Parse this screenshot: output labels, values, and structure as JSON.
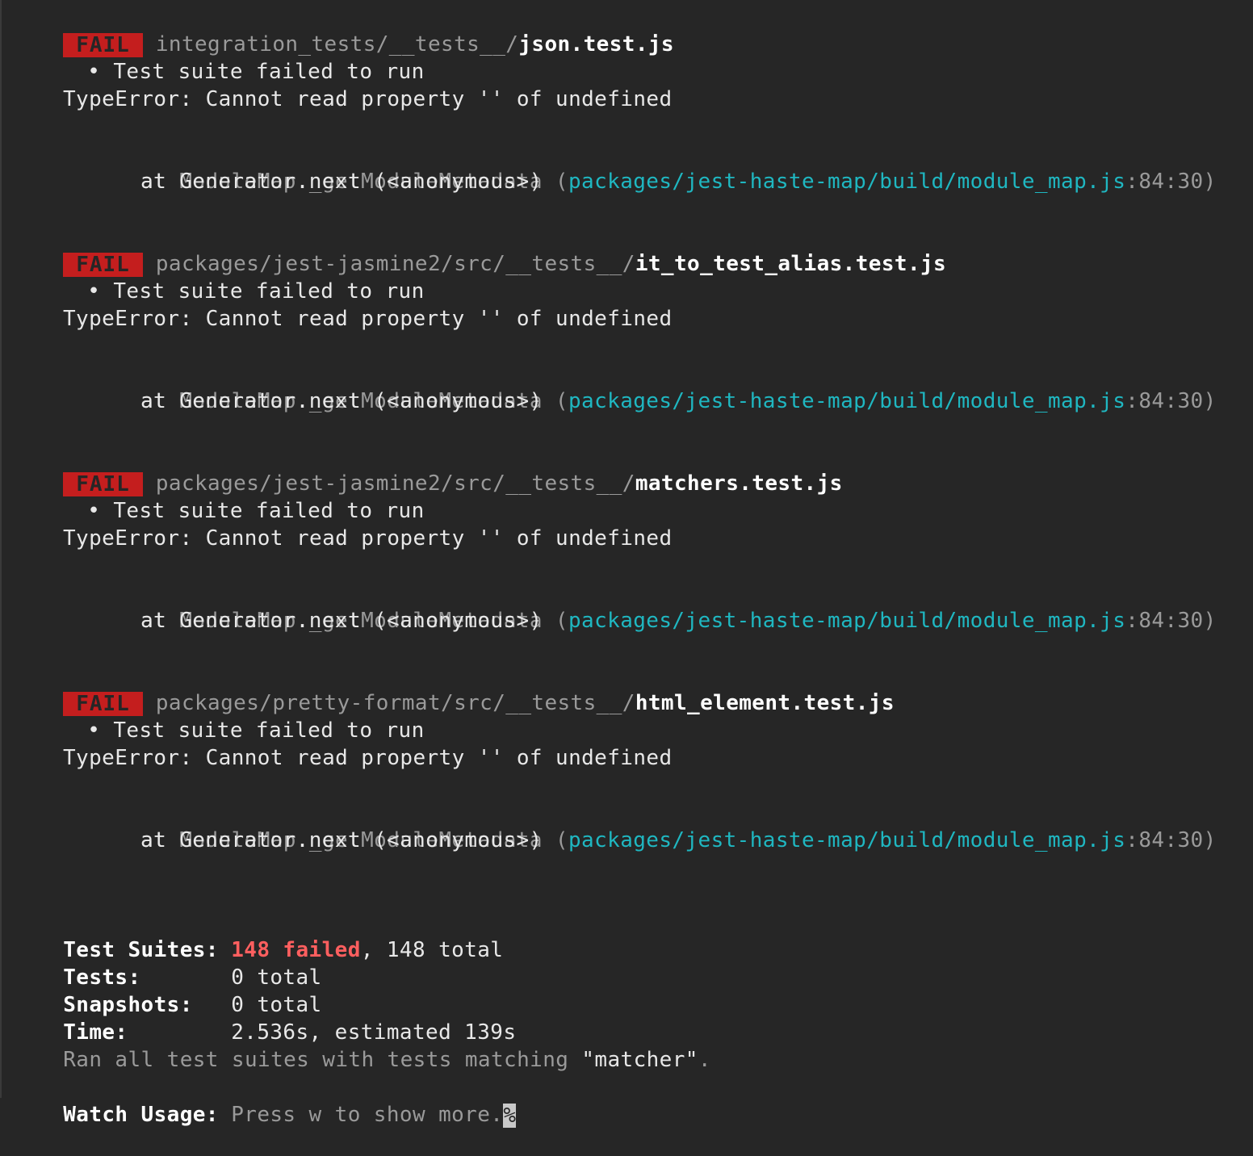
{
  "failures": [
    {
      "badge": "FAIL",
      "path_dim": "integration_tests/__tests__/",
      "file": "json.test.js",
      "bullet": "•",
      "message": "Test suite failed to run",
      "error": "TypeError: Cannot read property '' of undefined",
      "stack1_prefix": "at ModuleMap._getModuleMetadata (",
      "stack1_path": "packages/jest-haste-map/build/module_map.js",
      "stack1_loc": ":84:30)",
      "stack2": "at Generator.next (<anonymous>)"
    },
    {
      "badge": "FAIL",
      "path_dim": "packages/jest-jasmine2/src/__tests__/",
      "file": "it_to_test_alias.test.js",
      "bullet": "•",
      "message": "Test suite failed to run",
      "error": "TypeError: Cannot read property '' of undefined",
      "stack1_prefix": "at ModuleMap._getModuleMetadata (",
      "stack1_path": "packages/jest-haste-map/build/module_map.js",
      "stack1_loc": ":84:30)",
      "stack2": "at Generator.next (<anonymous>)"
    },
    {
      "badge": "FAIL",
      "path_dim": "packages/jest-jasmine2/src/__tests__/",
      "file": "matchers.test.js",
      "bullet": "•",
      "message": "Test suite failed to run",
      "error": "TypeError: Cannot read property '' of undefined",
      "stack1_prefix": "at ModuleMap._getModuleMetadata (",
      "stack1_path": "packages/jest-haste-map/build/module_map.js",
      "stack1_loc": ":84:30)",
      "stack2": "at Generator.next (<anonymous>)"
    },
    {
      "badge": "FAIL",
      "path_dim": "packages/pretty-format/src/__tests__/",
      "file": "html_element.test.js",
      "bullet": "•",
      "message": "Test suite failed to run",
      "error": "TypeError: Cannot read property '' of undefined",
      "stack1_prefix": "at ModuleMap._getModuleMetadata (",
      "stack1_path": "packages/jest-haste-map/build/module_map.js",
      "stack1_loc": ":84:30)",
      "stack2": "at Generator.next (<anonymous>)"
    }
  ],
  "summary": {
    "suites_label": "Test Suites:",
    "suites_failed": "148 failed",
    "suites_rest": ", 148 total",
    "tests_label": "Tests:",
    "tests_value": "0 total",
    "snapshots_label": "Snapshots:",
    "snapshots_value": "0 total",
    "time_label": "Time:",
    "time_value": "2.536s, estimated 139s",
    "ran_prefix": "Ran all test suites with tests matching ",
    "ran_pattern": "\"matcher\"",
    "ran_suffix": "."
  },
  "watch": {
    "label": "Watch Usage:",
    "text": "Press w to show more.",
    "cursor": "%"
  },
  "colors": {
    "background": "#262626",
    "fail_badge": "#c41e1e",
    "path_cyan": "#1fb7c1",
    "failed_count": "#ff5f5f",
    "dim_text": "#9a9a9a"
  }
}
